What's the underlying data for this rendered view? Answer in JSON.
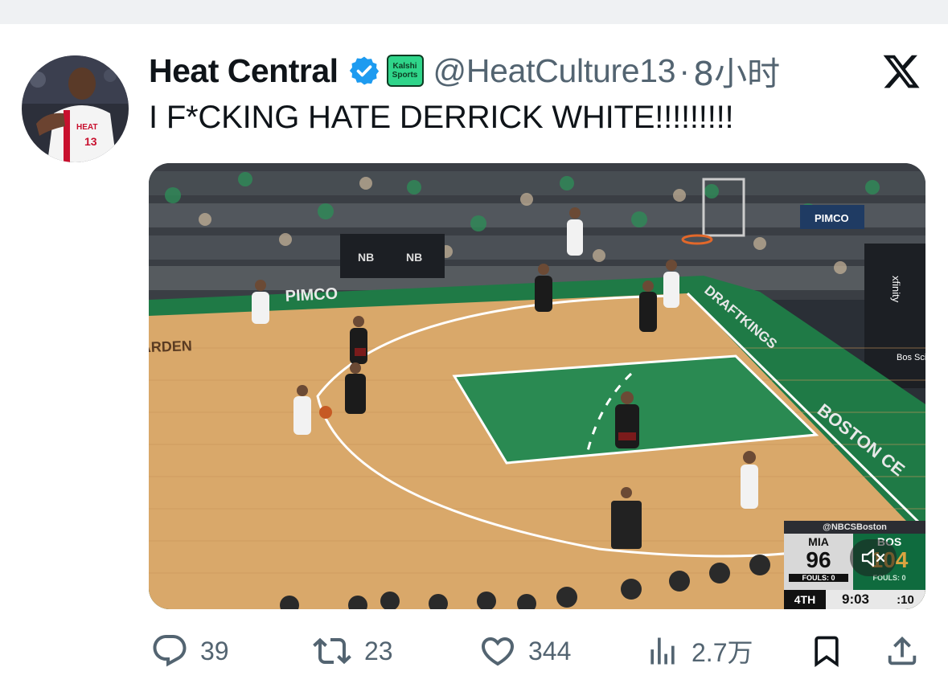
{
  "tweet": {
    "display_name": "Heat Central",
    "handle": "@HeatCulture13",
    "separator": "·",
    "time_ago": "8小时",
    "text": "I F*CKING HATE DERRICK WHITE!!!!!!!!!",
    "affiliate_badge": {
      "line1": "Kalshi",
      "line2": "Sports"
    },
    "icons": {
      "avatar": "player-avatar",
      "verified": "verified-badge-icon",
      "platform": "x-logo-icon"
    }
  },
  "media": {
    "court_signage": {
      "pimco_floor": "PIMCO",
      "pimco_board": "PIMCO",
      "garden_floor": "ARDEN",
      "draftkings": "DRAFTKINGS",
      "boston": "BOSTON CE",
      "xfinity": "xfinity",
      "bos_sci": "Bos Scie"
    },
    "scorebug": {
      "source": "@NBCSBoston",
      "team_a": "MIA",
      "team_a_score": "96",
      "team_a_fouls": "FOULS: 0",
      "team_b": "BOS",
      "team_b_score": "104",
      "team_b_fouls": "FOULS: 0",
      "period": "4TH",
      "game_clock": "9:03",
      "shot_clock": ":10"
    },
    "mute_icon": "speaker-muted-icon"
  },
  "actions": {
    "replies": "39",
    "retweets": "23",
    "likes": "344",
    "views": "2.7万"
  },
  "colors": {
    "secondary_text": "#536471",
    "verified_blue": "#1d9bf0",
    "court_green": "#1f7a46",
    "hardwood": "#d9a86a"
  }
}
